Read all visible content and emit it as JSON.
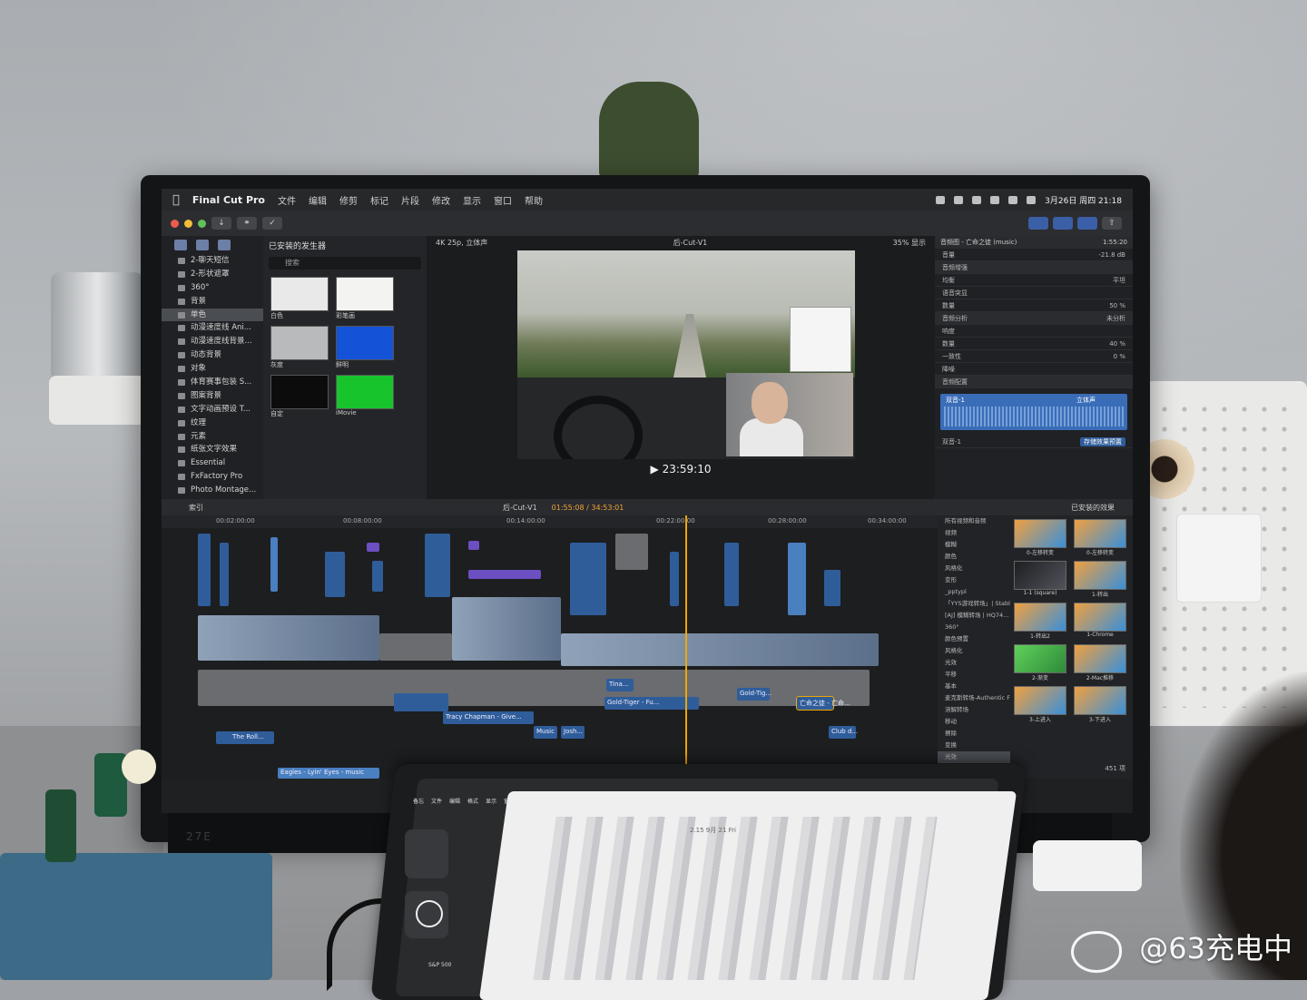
{
  "menubar": {
    "app_name": "Final Cut Pro",
    "menu_items": [
      "文件",
      "编辑",
      "修剪",
      "标记",
      "片段",
      "修改",
      "显示",
      "窗口",
      "帮助"
    ],
    "clock": "3月26日 周四 21:18"
  },
  "sidebar": {
    "items": [
      "2-聊天短信",
      "2-形状遮罩",
      "360°",
      "背景",
      "单色",
      "动漫速度线 Ani...",
      "动漫速度线背景...",
      "动态背景",
      "对象",
      "体育赛事包装 S...",
      "图案背景",
      "文字动画预设 T...",
      "纹理",
      "元素",
      "纸张文字效果",
      "Essential",
      "FxFactory Pro",
      "Photo Montage..."
    ],
    "selected": "单色"
  },
  "browser": {
    "title": "已安装的发生器",
    "search_placeholder": "搜索",
    "swatches": [
      {
        "label": "白色",
        "color": "#e9e9e9"
      },
      {
        "label": "彩笔画",
        "color": "#f3f3f1"
      },
      {
        "label": "灰度",
        "color": "#b9babc"
      },
      {
        "label": "鲜明",
        "color": "#1452d8"
      },
      {
        "label": "自定",
        "color": "#0c0c0d"
      },
      {
        "label": "iMovie",
        "color": "#17c42c"
      }
    ]
  },
  "viewer": {
    "format": "4K 25p, 立体声",
    "project": "后-Cut-V1",
    "zoom": "35%",
    "display": "显示",
    "timecode": "23:59:10"
  },
  "inspector": {
    "clip_title": "音频图 - 亡命之徒 (music)",
    "duration": "1:55:20",
    "rows": [
      {
        "label": "音量",
        "value": "-21.8 dB"
      },
      {
        "label": "音频增强",
        "value": ""
      },
      {
        "label": "均衡",
        "value": "平坦"
      },
      {
        "label": "语音突显",
        "value": ""
      },
      {
        "label": "数量",
        "value": "50 %"
      },
      {
        "label": "音频分析",
        "value": "未分析"
      },
      {
        "label": "响度",
        "value": ""
      },
      {
        "label": "数量",
        "value": "40 %"
      },
      {
        "label": "一致性",
        "value": "0 %"
      },
      {
        "label": "降噪",
        "value": ""
      },
      {
        "label": "音频配置",
        "value": ""
      }
    ],
    "audio_channel_1": "双音-1",
    "audio_channel_1_mode": "立体声",
    "audio_channel_2": "双音-1",
    "save_button": "存储效果预置"
  },
  "timeline": {
    "index_label": "索引",
    "project": "后-Cut-V1",
    "position": "01:55:08 / 34:53:01",
    "library_label": "已安装的效果",
    "ruler": [
      "00:02:00:00",
      "00:08:00:00",
      "00:14:00:00",
      "00:22:00:00",
      "00:28:00:00",
      "00:34:00:00"
    ],
    "clips": [
      "Tracy Chapman - Give...",
      "Gold-Tiger - Fu...",
      "Tina...",
      "Music",
      "Josh...",
      "Eagles - Lyin' Eyes - music",
      "The Roll...",
      "亡命之徒 - 亡命...",
      "Club d...",
      "Gold-Tig..."
    ]
  },
  "effects": {
    "categories": [
      "所有视频和音频",
      "视频",
      "模糊",
      "颜色",
      "风格化",
      "变形",
      "_pptypl",
      "「YYS游戏转场」| Stabl...",
      "[AJ] 模糊转场 | HQ74...",
      "360°",
      "颜色预置",
      "风格化",
      "光效",
      "平移",
      "基本",
      "麦克斯转场-Authentic Fil...",
      "溶解转场",
      "移动",
      "擦除",
      "变换",
      "光效"
    ],
    "selected": "光效",
    "count": "451 项",
    "items": [
      {
        "label": "0-左移转变",
        "style": "orange"
      },
      {
        "label": "0-左移转变",
        "style": "orange"
      },
      {
        "label": "1-1 (square)",
        "style": "dark"
      },
      {
        "label": "1-转出",
        "style": "orange"
      },
      {
        "label": "1-转出2",
        "style": "orange"
      },
      {
        "label": "1-Chrome",
        "style": "orange"
      },
      {
        "label": "2-渐变",
        "style": "green"
      },
      {
        "label": "2-Mac推移",
        "style": "orange"
      },
      {
        "label": "3-上进入",
        "style": "orange"
      },
      {
        "label": "3-下进入",
        "style": "orange"
      }
    ]
  },
  "ipad": {
    "menu": [
      "备忘",
      "文件",
      "编辑",
      "格式",
      "显示",
      "窗口",
      "帮助"
    ],
    "doc_title": "2.15 9月 21 Fri",
    "stock": "S&P 500"
  },
  "watermark": "@63充电中",
  "monitor_brand": "27E"
}
